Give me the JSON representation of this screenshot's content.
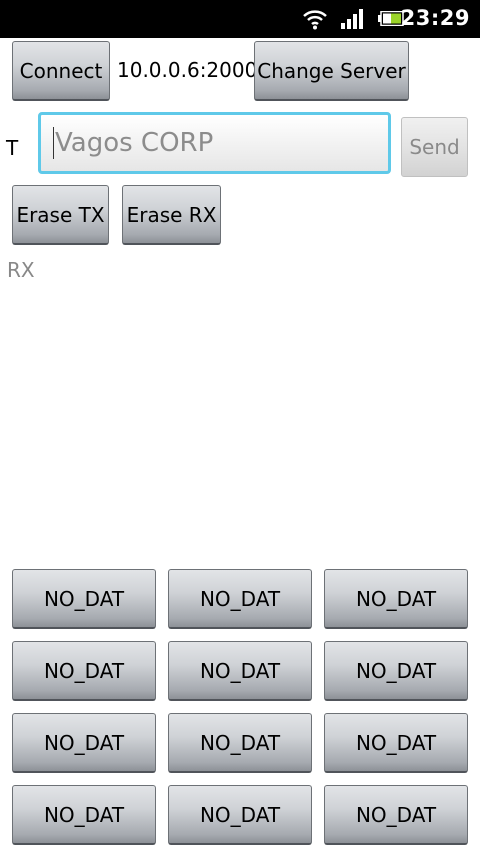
{
  "status": {
    "time": "23:29"
  },
  "connection": {
    "connect_label": "Connect",
    "address": "10.0.0.6:2000",
    "change_server_label": "Change Server"
  },
  "tx": {
    "label": "T",
    "input_value": "Vagos CORP",
    "send_label": "Send"
  },
  "actions": {
    "erase_tx_label": "Erase TX",
    "erase_rx_label": "Erase RX"
  },
  "rx": {
    "label": "RX"
  },
  "data_buttons": [
    "NO_DAT",
    "NO_DAT",
    "NO_DAT",
    "NO_DAT",
    "NO_DAT",
    "NO_DAT",
    "NO_DAT",
    "NO_DAT",
    "NO_DAT",
    "NO_DAT",
    "NO_DAT",
    "NO_DAT"
  ]
}
